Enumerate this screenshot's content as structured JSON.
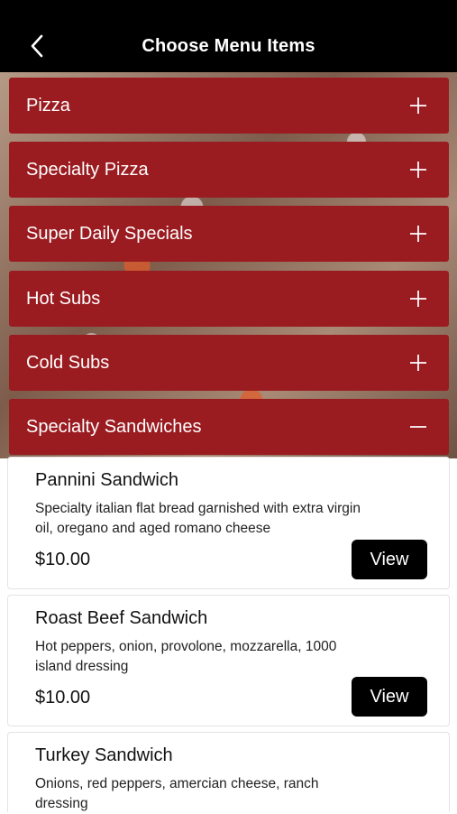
{
  "header": {
    "title": "Choose Menu Items",
    "back_icon": "chevron-left-icon"
  },
  "categories": [
    {
      "label": "Pizza",
      "icon": "plus-icon",
      "expanded": false
    },
    {
      "label": "Specialty Pizza",
      "icon": "plus-icon",
      "expanded": false
    },
    {
      "label": "Super Daily Specials",
      "icon": "plus-icon",
      "expanded": false
    },
    {
      "label": "Hot Subs",
      "icon": "plus-icon",
      "expanded": false
    },
    {
      "label": "Cold Subs",
      "icon": "plus-icon",
      "expanded": false
    },
    {
      "label": "Specialty Sandwiches",
      "icon": "minus-icon",
      "expanded": true
    }
  ],
  "items": [
    {
      "name": "Pannini Sandwich",
      "description": "Specialty italian flat bread garnished with extra virgin oil, oregano and aged romano cheese",
      "price": "$10.00",
      "button": "View"
    },
    {
      "name": "Roast Beef Sandwich",
      "description": "Hot peppers, onion, provolone, mozzarella, 1000 island dressing",
      "price": "$10.00",
      "button": "View"
    },
    {
      "name": "Turkey Sandwich",
      "description": "Onions, red peppers, amercian cheese, ranch dressing",
      "price": "",
      "button": ""
    }
  ],
  "colors": {
    "header_bg": "#000000",
    "category_bg": "#9a1b20",
    "button_bg": "#000000"
  }
}
